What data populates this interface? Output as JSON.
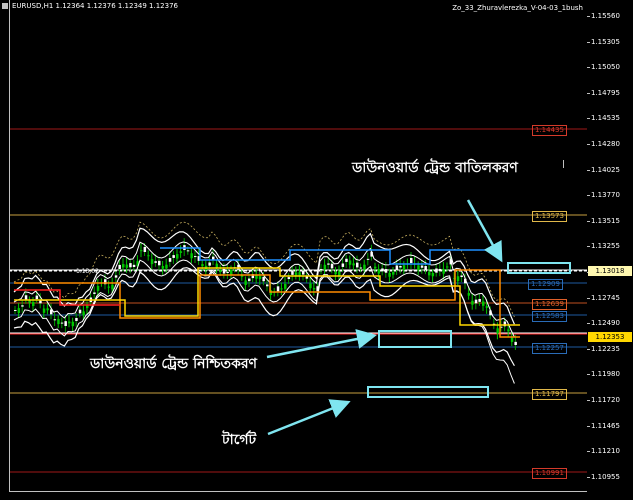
{
  "window": {
    "symbol_info": "EURUSD,H1  1.12364 1.12376 1.12349 1.12376",
    "indicator_name": "Zo_33_Zhuravlerezka_V-04-03_1bush"
  },
  "price_axis": {
    "ticks": [
      "1.15560",
      "1.15305",
      "1.15050",
      "1.14795",
      "1.14535",
      "1.14280",
      "1.14025",
      "1.13770",
      "1.13515",
      "1.13255",
      "1.13000",
      "1.12745",
      "1.12490",
      "1.12235",
      "1.11980",
      "1.11720",
      "1.11465",
      "1.11210",
      "1.10955"
    ],
    "current_price": "1.12353",
    "marked_price": "1.13018"
  },
  "levels": [
    {
      "label": "1.14435",
      "color": "#d43a2a"
    },
    {
      "label": "1.13573",
      "color": "#e0b84a"
    },
    {
      "label": "1.12909",
      "color": "#2a6cb8"
    },
    {
      "label": "1.12639",
      "color": "#e0602a"
    },
    {
      "label": "1.12583",
      "color": "#2a6cb8"
    },
    {
      "label": "1.12257",
      "color": "#2a6cb8"
    },
    {
      "label": "1.11797",
      "color": "#e0b84a"
    },
    {
      "label": "1.10991",
      "color": "#d43a2a"
    }
  ],
  "annotations": {
    "downtrend_cancel": "ডাউনওয়ার্ড ট্রেন্ড বাতিলকরণ",
    "downtrend_confirm": "ডাউনওয়ার্ড ট্রেন্ড নিশ্চিতকরণ",
    "target": "টার্গেট",
    "annotation_color": "#ffffff",
    "arrow_color": "#7fe5f0"
  },
  "chart_small_label": "1.13.02",
  "colors": {
    "background": "#000000",
    "bull_candle": "#00c800",
    "bear_candle": "#ffffff",
    "envelope": "#ffffff",
    "orange_line": "#ff8c00",
    "yellow_line": "#ffd700",
    "blue_line": "#1e90ff",
    "red_line": "#ff2020"
  }
}
